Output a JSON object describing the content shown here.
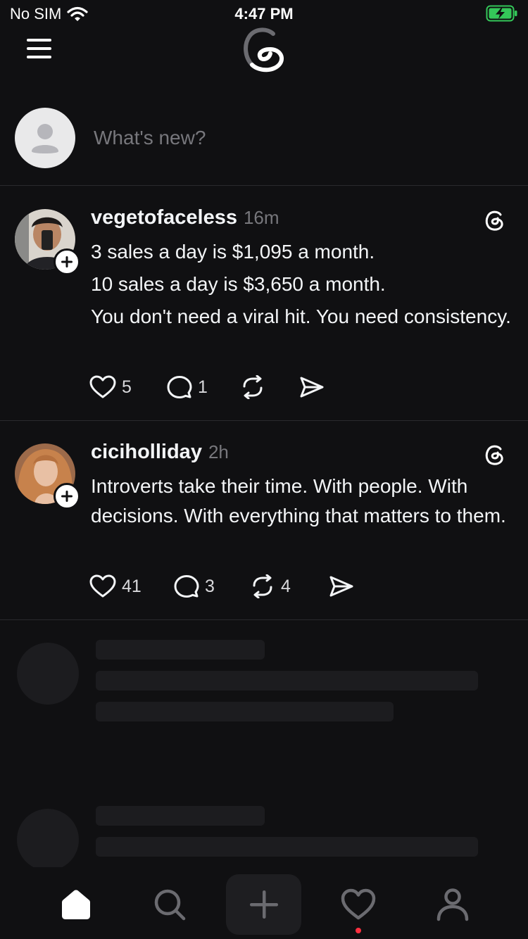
{
  "status_bar": {
    "carrier": "No SIM",
    "time": "4:47 PM"
  },
  "composer": {
    "placeholder": "What's new?"
  },
  "posts": [
    {
      "username": "vegetofaceless",
      "time": "16m",
      "lines": [
        "3 sales a day is $1,095 a month.",
        "10 sales a day is $3,650 a month.",
        "You don't need a viral hit. You need consistency."
      ],
      "likes": "5",
      "replies": "1",
      "reposts": "",
      "avatar_color": "#3a2c24"
    },
    {
      "username": "ciciholliday",
      "time": "2h",
      "lines": [
        "Introverts take their time. With people. With decisions. With everything that matters to them."
      ],
      "likes": "41",
      "replies": "3",
      "reposts": "4",
      "avatar_color": "#c98a5a"
    }
  ],
  "colors": {
    "background": "#101012",
    "text_primary": "#f3f5f7",
    "text_secondary": "#77777c",
    "divider": "#2a2a2d",
    "skeleton": "#1c1c1f",
    "battery_fill": "#34c759",
    "notification_dot": "#ff3040"
  },
  "icons": {
    "menu": "menu-icon",
    "logo": "threads-logo-icon",
    "like": "heart-icon",
    "reply": "comment-icon",
    "repost": "repost-icon",
    "share": "send-icon",
    "tabs": [
      "home-icon",
      "search-icon",
      "plus-icon",
      "heart-icon",
      "profile-icon"
    ]
  }
}
